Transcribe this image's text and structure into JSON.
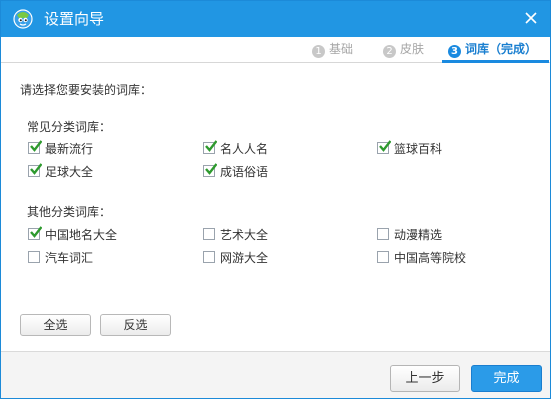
{
  "window": {
    "title": "设置向导",
    "accent": "#2196e3"
  },
  "tabs": [
    {
      "num": "1",
      "label": "基础",
      "active": false
    },
    {
      "num": "2",
      "label": "皮肤",
      "active": false
    },
    {
      "num": "3",
      "label": "词库（完成）",
      "active": true
    }
  ],
  "instruction": "请选择您要安装的词库：",
  "common": {
    "label": "常见分类词库：",
    "items": [
      {
        "label": "最新流行",
        "checked": true
      },
      {
        "label": "名人人名",
        "checked": true
      },
      {
        "label": "篮球百科",
        "checked": true
      },
      {
        "label": "足球大全",
        "checked": true
      },
      {
        "label": "成语俗语",
        "checked": true
      }
    ]
  },
  "other": {
    "label": "其他分类词库：",
    "items": [
      {
        "label": "中国地名大全",
        "checked": true
      },
      {
        "label": "艺术大全",
        "checked": false
      },
      {
        "label": "动漫精选",
        "checked": false
      },
      {
        "label": "汽车词汇",
        "checked": false
      },
      {
        "label": "网游大全",
        "checked": false
      },
      {
        "label": "中国高等院校",
        "checked": false
      }
    ]
  },
  "buttons": {
    "select_all": "全选",
    "invert": "反选",
    "prev": "上一步",
    "finish": "完成"
  },
  "icons": {
    "app": "app-logo-icon",
    "close": "close-icon",
    "check": "checkmark-icon"
  },
  "colors": {
    "check_green": "#2e9a2e",
    "tab_active": "#1a8ae0"
  }
}
